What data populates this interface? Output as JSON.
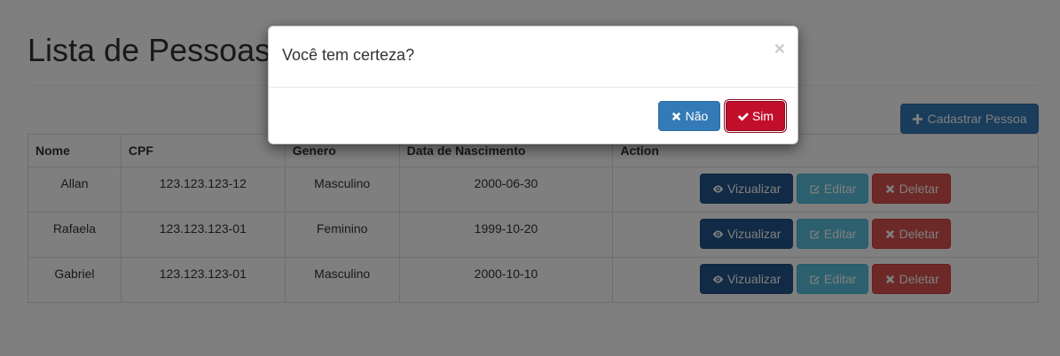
{
  "page": {
    "title": "Lista de Pessoas",
    "add_button_label": "Cadastrar Pessoa"
  },
  "table": {
    "headers": [
      "Nome",
      "CPF",
      "Genero",
      "Data de Nascimento",
      "Action"
    ],
    "rows": [
      {
        "nome": "Allan",
        "cpf": "123.123.123-12",
        "genero": "Masculino",
        "nascimento": "2000-06-30"
      },
      {
        "nome": "Rafaela",
        "cpf": "123.123.123-01",
        "genero": "Feminino",
        "nascimento": "1999-10-20"
      },
      {
        "nome": "Gabriel",
        "cpf": "123.123.123-01",
        "genero": "Masculino",
        "nascimento": "2000-10-10"
      }
    ],
    "actions": {
      "view_label": "Vizualizar",
      "edit_label": "Editar",
      "delete_label": "Deletar"
    }
  },
  "modal": {
    "title": "Você tem certeza?",
    "close_symbol": "×",
    "no_label": "Não",
    "yes_label": "Sim"
  },
  "icons": {
    "add": "plus-icon",
    "view": "eye-icon",
    "edit": "edit-icon",
    "delete": "times-icon",
    "confirm": "check-icon",
    "close": "close-icon"
  },
  "colors": {
    "primary": "#337ab7",
    "info": "#5bc0de",
    "danger": "#d9534f",
    "confirm": "#c10f2b"
  }
}
